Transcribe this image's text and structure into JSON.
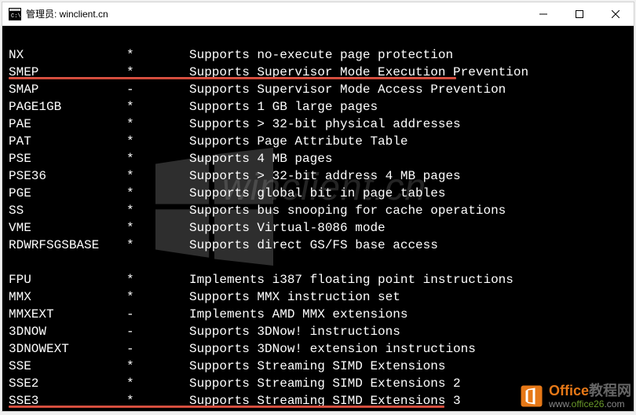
{
  "titlebar": {
    "text": "管理员: winclient.cn"
  },
  "rows": [
    {
      "name": "",
      "flag": "",
      "desc": ""
    },
    {
      "name": "NX",
      "flag": "*",
      "desc": "Supports no-execute page protection"
    },
    {
      "name": "SMEP",
      "flag": "*",
      "desc": "Supports Supervisor Mode Execution Prevention"
    },
    {
      "name": "SMAP",
      "flag": "-",
      "desc": "Supports Supervisor Mode Access Prevention"
    },
    {
      "name": "PAGE1GB",
      "flag": "*",
      "desc": "Supports 1 GB large pages"
    },
    {
      "name": "PAE",
      "flag": "*",
      "desc": "Supports > 32-bit physical addresses"
    },
    {
      "name": "PAT",
      "flag": "*",
      "desc": "Supports Page Attribute Table"
    },
    {
      "name": "PSE",
      "flag": "*",
      "desc": "Supports 4 MB pages"
    },
    {
      "name": "PSE36",
      "flag": "*",
      "desc": "Supports > 32-bit address 4 MB pages"
    },
    {
      "name": "PGE",
      "flag": "*",
      "desc": "Supports global bit in page tables"
    },
    {
      "name": "SS",
      "flag": "*",
      "desc": "Supports bus snooping for cache operations"
    },
    {
      "name": "VME",
      "flag": "*",
      "desc": "Supports Virtual-8086 mode"
    },
    {
      "name": "RDWRFSGSBASE",
      "flag": "*",
      "desc": "Supports direct GS/FS base access"
    },
    {
      "name": "",
      "flag": "",
      "desc": ""
    },
    {
      "name": "FPU",
      "flag": "*",
      "desc": "Implements i387 floating point instructions"
    },
    {
      "name": "MMX",
      "flag": "*",
      "desc": "Supports MMX instruction set"
    },
    {
      "name": "MMXEXT",
      "flag": "-",
      "desc": "Implements AMD MMX extensions"
    },
    {
      "name": "3DNOW",
      "flag": "-",
      "desc": "Supports 3DNow! instructions"
    },
    {
      "name": "3DNOWEXT",
      "flag": "-",
      "desc": "Supports 3DNow! extension instructions"
    },
    {
      "name": "SSE",
      "flag": "*",
      "desc": "Supports Streaming SIMD Extensions"
    },
    {
      "name": "SSE2",
      "flag": "*",
      "desc": "Supports Streaming SIMD Extensions 2"
    },
    {
      "name": "SSE3",
      "flag": "*",
      "desc": "Supports Streaming SIMD Extensions 3"
    }
  ],
  "watermark": {
    "text": "winclient.cn"
  },
  "office_watermark": {
    "title_part1": "Office",
    "title_part2": "教程网",
    "url_prefix": "www.",
    "url_mid": "office26",
    "url_suffix": ".com"
  }
}
